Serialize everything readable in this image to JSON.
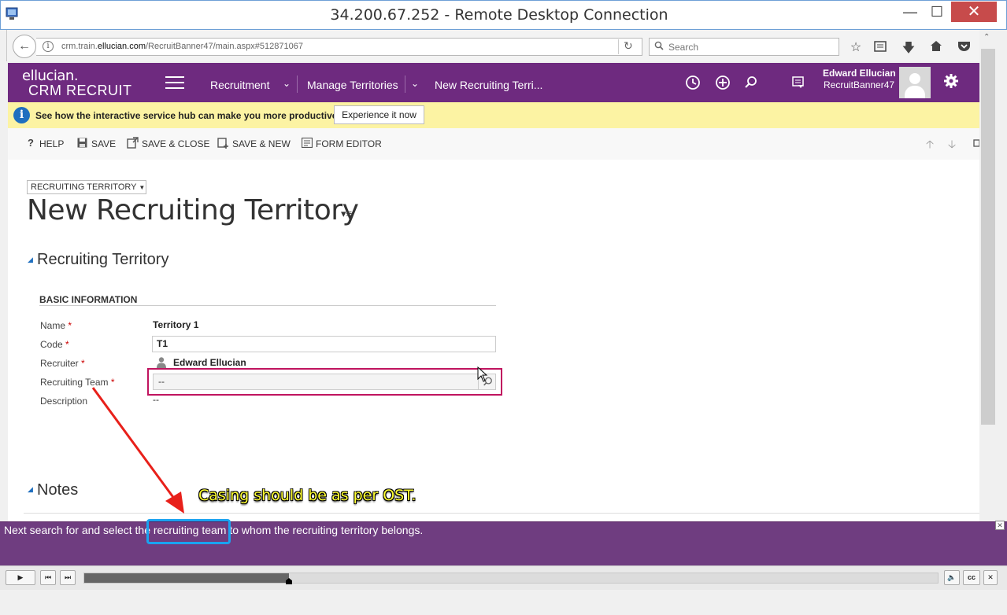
{
  "rdp": {
    "title": "34.200.67.252 - Remote Desktop Connection",
    "minimize": "—",
    "maximize": "☐",
    "close": "✕"
  },
  "browser": {
    "url_prefix": "crm.train.",
    "url_domain": "ellucian.com",
    "url_suffix": "/RecruitBanner47/main.aspx#512871067",
    "search_placeholder": "Search"
  },
  "crm": {
    "logo_line1": "ellucian.",
    "logo_line2": "CRM RECRUIT",
    "nav": [
      "Recruitment",
      "Manage Territories",
      "New Recruiting Terri..."
    ],
    "user_name": "Edward Ellucian",
    "user_org": "RecruitBanner47"
  },
  "notification": {
    "text": "See how the interactive service hub can make you more productive.",
    "button": "Experience it now"
  },
  "commands": {
    "help": "HELP",
    "save": "SAVE",
    "save_close": "SAVE & CLOSE",
    "save_new": "SAVE & NEW",
    "form_editor": "FORM EDITOR"
  },
  "form": {
    "selector": "RECRUITING TERRITORY",
    "title": "New Recruiting Territory",
    "section": "Recruiting Territory",
    "subsection": "BASIC INFORMATION",
    "fields": {
      "name_label": "Name",
      "name_value": "Territory 1",
      "code_label": "Code",
      "code_value": "T1",
      "recruiter_label": "Recruiter",
      "recruiter_value": "Edward Ellucian",
      "team_label": "Recruiting Team",
      "team_value": "--",
      "description_label": "Description",
      "description_value": "--"
    },
    "notes_title": "Notes"
  },
  "annotation": {
    "note": "Casing should be as per OST.",
    "arrow_color": "#e8201a",
    "highlight_color": "#1aa3f0"
  },
  "caption": {
    "text": "Next search for and select the recruiting team to whom the recruiting territory belongs."
  },
  "player": {
    "progress": 0.24
  },
  "colors": {
    "brand": "#6e2a7f",
    "notification_bg": "#fcf3a3",
    "caption_bg": "#6f3d80",
    "required": "#cc0000"
  }
}
